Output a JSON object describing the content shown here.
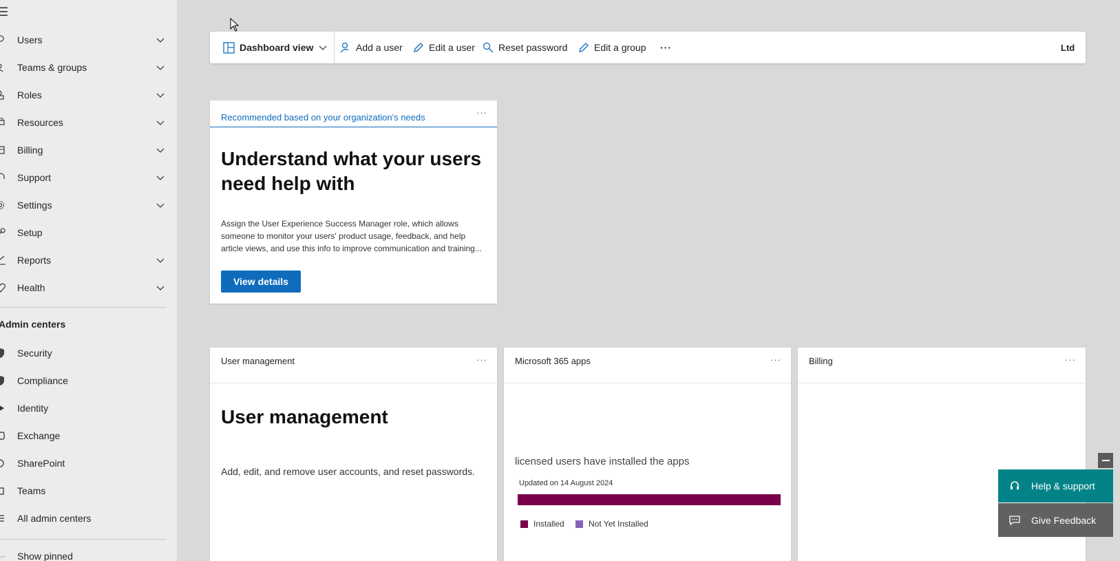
{
  "sidebar": {
    "items": [
      {
        "label": "Users",
        "icon": "person-icon",
        "expandable": true
      },
      {
        "label": "Teams & groups",
        "icon": "people-icon",
        "expandable": true
      },
      {
        "label": "Roles",
        "icon": "roles-icon",
        "expandable": true
      },
      {
        "label": "Resources",
        "icon": "printer-icon",
        "expandable": true
      },
      {
        "label": "Billing",
        "icon": "billing-icon",
        "expandable": true
      },
      {
        "label": "Support",
        "icon": "headset-icon",
        "expandable": true
      },
      {
        "label": "Settings",
        "icon": "gear-icon",
        "expandable": true
      },
      {
        "label": "Setup",
        "icon": "wrench-icon",
        "expandable": false
      },
      {
        "label": "Reports",
        "icon": "chart-icon",
        "expandable": true
      },
      {
        "label": "Health",
        "icon": "heart-icon",
        "expandable": true
      }
    ],
    "admin_centers_label": "Admin centers",
    "admin_centers": [
      {
        "label": "Security",
        "icon": "shield-icon"
      },
      {
        "label": "Compliance",
        "icon": "compliance-icon"
      },
      {
        "label": "Identity",
        "icon": "identity-icon"
      },
      {
        "label": "Exchange",
        "icon": "exchange-icon"
      },
      {
        "label": "SharePoint",
        "icon": "sharepoint-icon"
      },
      {
        "label": "Teams",
        "icon": "teams-icon"
      },
      {
        "label": "All admin centers",
        "icon": "list-icon"
      }
    ],
    "show_pinned": "Show pinned"
  },
  "toolbar": {
    "dashboard_view": "Dashboard view",
    "add_user": "Add a user",
    "edit_user": "Edit a user",
    "reset_password": "Reset password",
    "edit_group": "Edit a group",
    "more": "···",
    "org_name": "Ltd"
  },
  "recommendation_card": {
    "header": "Recommended based on your organization's needs",
    "more": "···",
    "title_line1": "Understand what your users",
    "title_line2": "need help with",
    "body_line1": "Assign the User Experience Success Manager role, which allows",
    "body_line2": "someone to monitor your users' product usage, feedback, and help",
    "body_line3": "article views, and use this info to improve communication and training...",
    "button": "View details"
  },
  "user_management_card": {
    "header": "User management",
    "more": "···",
    "title": "User management",
    "body": "Add, edit, and remove user accounts, and reset passwords."
  },
  "apps_card": {
    "header": "Microsoft 365 apps",
    "more": "···",
    "text": "licensed users have installed the apps",
    "updated": "Updated on 14 August 2024",
    "installed_fraction": 1.0,
    "legend_installed": "Installed",
    "legend_not_installed": "Not Yet Installed",
    "color_installed": "#7a0049",
    "color_not_installed": "#8764b8"
  },
  "billing_card": {
    "header": "Billing",
    "more": "···"
  },
  "help_panel": {
    "help_support": "Help & support",
    "give_feedback": "Give Feedback"
  }
}
